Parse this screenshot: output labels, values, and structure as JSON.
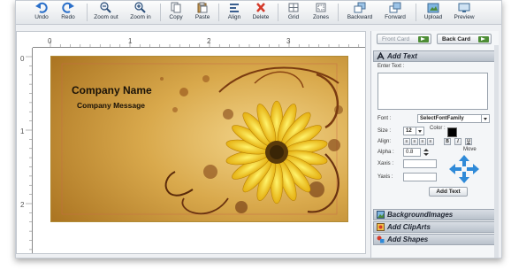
{
  "toolbar": {
    "items": [
      {
        "label": "Undo",
        "icon": "undo-icon"
      },
      {
        "label": "Redo",
        "icon": "redo-icon"
      },
      {
        "label": "Zoom out",
        "icon": "zoom-out-icon"
      },
      {
        "label": "Zoom in",
        "icon": "zoom-in-icon"
      },
      {
        "label": "Copy",
        "icon": "copy-icon"
      },
      {
        "label": "Paste",
        "icon": "paste-icon"
      },
      {
        "label": "Align",
        "icon": "align-icon"
      },
      {
        "label": "Delete",
        "icon": "delete-icon"
      },
      {
        "label": "Grid",
        "icon": "grid-icon"
      },
      {
        "label": "Zones",
        "icon": "zones-icon"
      },
      {
        "label": "Backward",
        "icon": "backward-icon"
      },
      {
        "label": "Forward",
        "icon": "forward-icon"
      },
      {
        "label": "Upload",
        "icon": "upload-icon"
      },
      {
        "label": "Preview",
        "icon": "preview-icon"
      }
    ]
  },
  "ruler": {
    "h_ticks": [
      "0",
      "1",
      "2",
      "3"
    ],
    "v_ticks": [
      "0",
      "1",
      "2"
    ]
  },
  "card": {
    "company_name": "Company Name",
    "company_message": "Company Message"
  },
  "panel": {
    "front_card": "Front Card",
    "back_card": "Back Card",
    "add_text_header": "Add Text",
    "enter_text_label": "Enter Text :",
    "font_label": "Font :",
    "font_value": "SelectFontFamily",
    "size_label": "Size :",
    "size_value": "12",
    "color_label": "Color :",
    "align_label": "Align:",
    "align_buttons": [
      "≡",
      "≡",
      "≡",
      "≡",
      "B",
      "I",
      "U"
    ],
    "alpha_label": "Alpha :",
    "alpha_value": "0.8",
    "move_label": "Move",
    "xaxis_label": "Xaxis :",
    "yaxis_label": "Yaxis :",
    "add_text_button": "Add Text",
    "sections": [
      "BackgroundImages",
      "Add ClipArts",
      "Add Shapes"
    ]
  },
  "colors": {
    "accent_red": "#d43a2a",
    "text_color_swatch": "#000000",
    "card_background": "#c99a3c",
    "flower": "#f0c419"
  }
}
